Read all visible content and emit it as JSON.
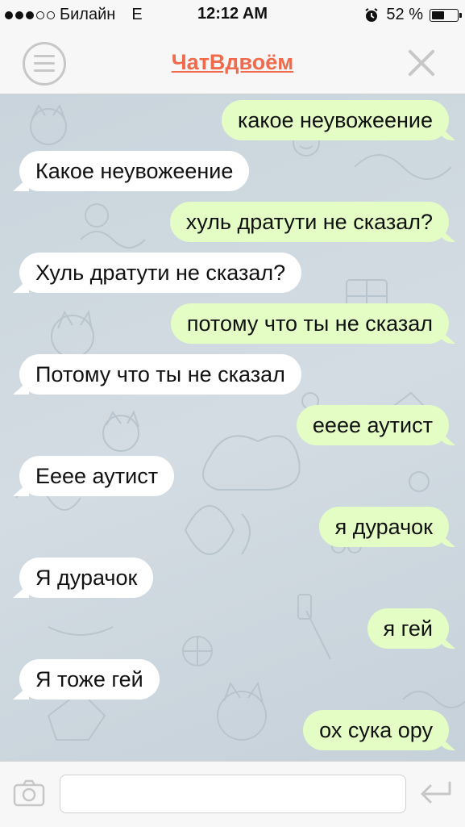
{
  "status_bar": {
    "carrier": "Билайн",
    "network": "E",
    "time": "12:12 AM",
    "battery_percent": "52 %",
    "battery_level": 0.52,
    "signal_bars_filled": 3,
    "signal_bars_total": 5,
    "alarm_icon": "alarm-clock-icon"
  },
  "navbar": {
    "title": "ЧатВдвоём",
    "menu_icon": "hamburger-menu-icon",
    "close_icon": "close-icon",
    "title_color": "#f06a4b"
  },
  "messages": [
    {
      "side": "out",
      "text": "какое неувожеение"
    },
    {
      "side": "in",
      "text": "Какое неувожеение"
    },
    {
      "side": "out",
      "text": "хуль дратути не сказал?"
    },
    {
      "side": "in",
      "text": "Хуль дратути не сказал?"
    },
    {
      "side": "out",
      "text": "потому что ты не сказал"
    },
    {
      "side": "in",
      "text": "Потому что ты не сказал"
    },
    {
      "side": "out",
      "text": "ееее аутист"
    },
    {
      "side": "in",
      "text": "Еeee аутист"
    },
    {
      "side": "out",
      "text": "я дурачок"
    },
    {
      "side": "in",
      "text": "Я дурачок"
    },
    {
      "side": "out",
      "text": "я гей"
    },
    {
      "side": "in",
      "text": "Я тоже гей"
    },
    {
      "side": "out",
      "text": "ох сука ору"
    }
  ],
  "input_bar": {
    "camera_icon": "camera-icon",
    "send_icon": "send-arrow-icon",
    "input_value": "",
    "input_placeholder": ""
  },
  "colors": {
    "outgoing_bubble": "#e3fdc5",
    "incoming_bubble": "#ffffff",
    "accent": "#f06a4b"
  }
}
